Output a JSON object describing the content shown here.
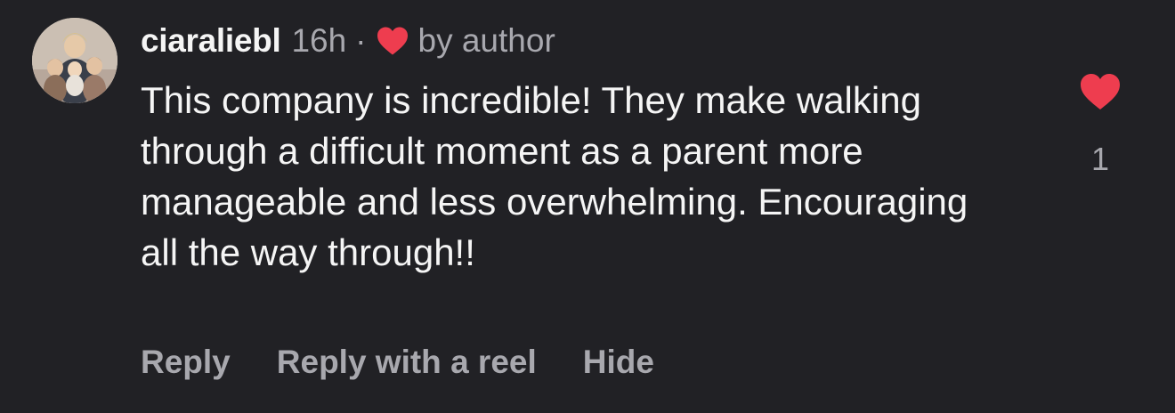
{
  "comment": {
    "username": "ciaraliebl",
    "time": "16h",
    "separator": "·",
    "liked_by_author_label": "by author",
    "text": "This company is incredible! They make walking through a difficult moment as a parent more manageable and less overwhelming. Encouraging all the way through!!",
    "like_count": "1",
    "actions": {
      "reply": "Reply",
      "reply_with_reel": "Reply with a reel",
      "hide": "Hide"
    }
  },
  "colors": {
    "background": "#212125",
    "text_primary": "#f5f5f5",
    "text_secondary": "#a8a8ae",
    "heart_red": "#ee3d4f"
  },
  "icons": {
    "author_like": "heart-icon",
    "like_button": "heart-filled-icon"
  }
}
